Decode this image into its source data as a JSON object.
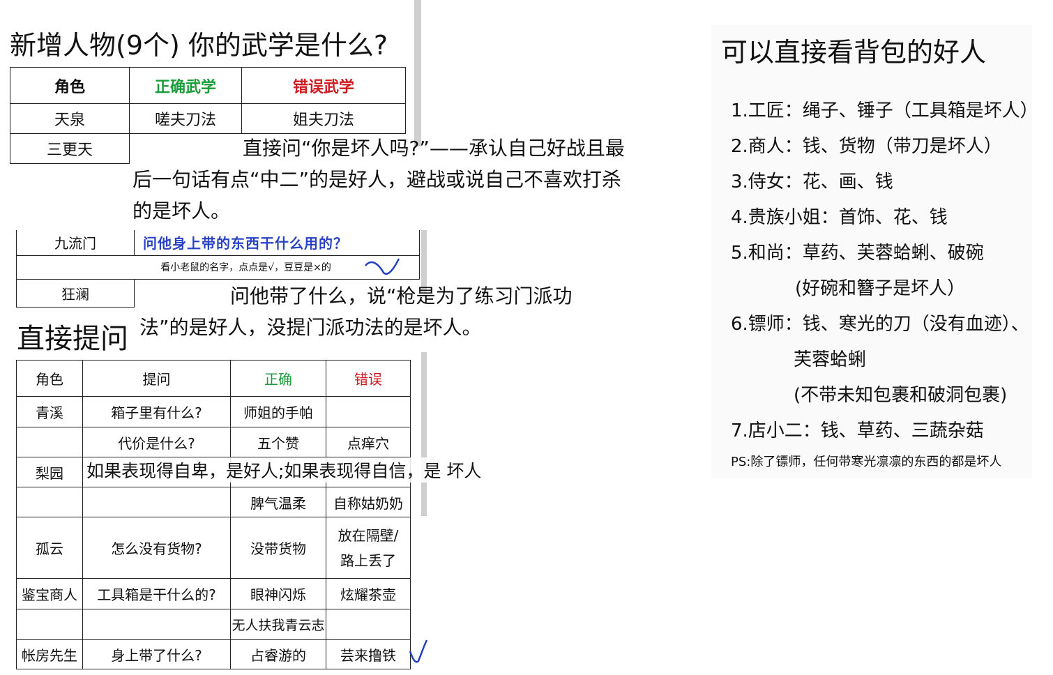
{
  "left": {
    "title": "新增人物(9个) 你的武学是什么?",
    "table1": {
      "headers": [
        "角色",
        "正确武学",
        "错误武学"
      ],
      "rows": [
        [
          "天泉",
          "嗟夫刀法",
          "姐夫刀法"
        ],
        [
          "三更天",
          "",
          ""
        ]
      ]
    },
    "sangengtian_note": "直接问“你是坏人吗?”——承认自己好战且最后一句话有点“中二”的是好人，避战或说自己不喜欢打杀的是坏人。",
    "jiuliumen": {
      "role": "九流门",
      "question": "问他身上带的东西干什么用的？",
      "hint": "看小老鼠的名字，点点是√，豆豆是×的"
    },
    "kuanglan": {
      "role": "狂澜",
      "note": "问他带了什么，说“枪是为了练习门派功法”的是好人，没提门派功法的是坏人。"
    },
    "section2_title": "直接提问",
    "table2": {
      "headers": [
        "角色",
        "提问",
        "正确",
        "错误"
      ],
      "rows": [
        [
          "青溪",
          "箱子里有什么?",
          "师姐的手帕",
          ""
        ],
        [
          "",
          "代价是什么?",
          "五个赞",
          "点痒穴"
        ],
        [
          "梨园",
          "",
          "",
          ""
        ],
        [
          "",
          "",
          "脾气温柔",
          "自称姑奶奶"
        ],
        [
          "孤云",
          "怎么没有货物?",
          "没带货物",
          "放在隔壁/路上丢了"
        ],
        [
          "鉴宝商人",
          "工具箱是干什么的?",
          "眼神闪烁",
          "炫耀茶壶"
        ],
        [
          "",
          "",
          "无人扶我青云志",
          ""
        ],
        [
          "帐房先生",
          "身上带了什么?",
          "占睿游的",
          "芸来撸铁"
        ]
      ]
    },
    "liyuan_note": "如果表现得自卑，是好人;如果表现得自信，是 坏人"
  },
  "right": {
    "title": "可以直接看背包的好人",
    "lines": [
      "1.工匠：绳子、锤子（工具箱是坏人）",
      "2.商人：钱、货物（带刀是坏人）",
      "3.侍女：花、画、钱",
      "4.贵族小姐：首饰、花、钱",
      "5.和尚：草药、芙蓉蛤蜊、破碗",
      "(好碗和簪子是坏人）",
      "6.镖师：钱、寒光的刀（没有血迹）、",
      "芙蓉蛤蜊",
      "(不带未知包裹和破洞包裹)",
      "7.店小二：钱、草药、三蔬杂菇"
    ],
    "ps": "PS:除了镖师，任何带寒光凛凛的东西的都是坏人"
  },
  "colors": {
    "correct": "#1a9c3a",
    "wrong": "#d0191f",
    "question": "#2a43c4",
    "check": "#1f3fbf"
  }
}
